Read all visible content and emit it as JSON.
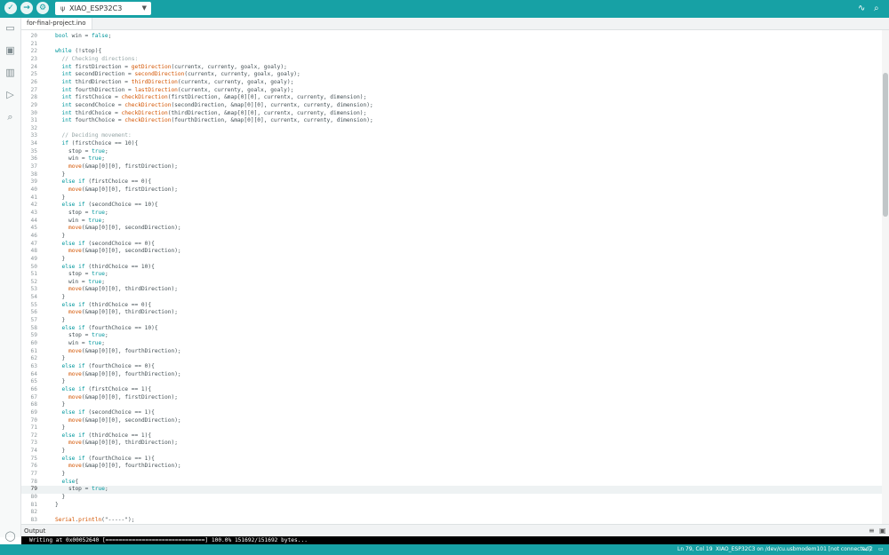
{
  "colors": {
    "accent": "#17a1a5",
    "keyword": "#00979d",
    "function": "#d35400",
    "comment": "#95a5a6",
    "text": "#434f54"
  },
  "toolbar": {
    "verify_icon": "check-icon",
    "upload_icon": "arrow-right-icon",
    "debug_icon": "debug-icon",
    "board_name": "XIAO_ESP32C3",
    "board_icon": "usb-icon"
  },
  "tab": {
    "label": "for-final-project.ino"
  },
  "code_lines": [
    {
      "n": "20",
      "indent": 1,
      "tokens": [
        [
          "k",
          "bool"
        ],
        [
          "t",
          " win = "
        ],
        [
          "k",
          "false"
        ],
        [
          "t",
          ";"
        ]
      ]
    },
    {
      "n": "21",
      "indent": 0,
      "tokens": []
    },
    {
      "n": "22",
      "indent": 1,
      "tokens": [
        [
          "k",
          "while"
        ],
        [
          "t",
          " (!stop){"
        ]
      ]
    },
    {
      "n": "23",
      "indent": 2,
      "tokens": [
        [
          "c",
          "// Checking directions:"
        ]
      ]
    },
    {
      "n": "24",
      "indent": 2,
      "tokens": [
        [
          "k",
          "int"
        ],
        [
          "t",
          " firstDirection = "
        ],
        [
          "f",
          "getDirection"
        ],
        [
          "t",
          "(currentx, currenty, goalx, goaly);"
        ]
      ]
    },
    {
      "n": "25",
      "indent": 2,
      "tokens": [
        [
          "k",
          "int"
        ],
        [
          "t",
          " secondDirection = "
        ],
        [
          "f",
          "secondDirection"
        ],
        [
          "t",
          "(currentx, currenty, goalx, goaly);"
        ]
      ]
    },
    {
      "n": "26",
      "indent": 2,
      "tokens": [
        [
          "k",
          "int"
        ],
        [
          "t",
          " thirdDirection = "
        ],
        [
          "f",
          "thirdDirection"
        ],
        [
          "t",
          "(currentx, currenty, goalx, goaly);"
        ]
      ]
    },
    {
      "n": "27",
      "indent": 2,
      "tokens": [
        [
          "k",
          "int"
        ],
        [
          "t",
          " fourthDirection = "
        ],
        [
          "f",
          "lastDirection"
        ],
        [
          "t",
          "(currentx, currenty, goalx, goaly);"
        ]
      ]
    },
    {
      "n": "28",
      "indent": 2,
      "tokens": [
        [
          "k",
          "int"
        ],
        [
          "t",
          " firstChoice = "
        ],
        [
          "f",
          "checkDirection"
        ],
        [
          "t",
          "(firstDirection, &map[0][0], currentx, currenty, dimension);"
        ]
      ]
    },
    {
      "n": "29",
      "indent": 2,
      "tokens": [
        [
          "k",
          "int"
        ],
        [
          "t",
          " secondChoice = "
        ],
        [
          "f",
          "checkDirection"
        ],
        [
          "t",
          "(secondDirection, &map[0][0], currentx, currenty, dimension);"
        ]
      ]
    },
    {
      "n": "30",
      "indent": 2,
      "tokens": [
        [
          "k",
          "int"
        ],
        [
          "t",
          " thirdChoice = "
        ],
        [
          "f",
          "checkDirection"
        ],
        [
          "t",
          "(thirdDirection, &map[0][0], currentx, currenty, dimension);"
        ]
      ]
    },
    {
      "n": "31",
      "indent": 2,
      "tokens": [
        [
          "k",
          "int"
        ],
        [
          "t",
          " fourthChoice = "
        ],
        [
          "f",
          "checkDirection"
        ],
        [
          "t",
          "(fourthDirection, &map[0][0], currentx, currenty, dimension);"
        ]
      ]
    },
    {
      "n": "32",
      "indent": 0,
      "tokens": []
    },
    {
      "n": "33",
      "indent": 2,
      "tokens": [
        [
          "c",
          "// Deciding movement:"
        ]
      ]
    },
    {
      "n": "34",
      "indent": 2,
      "tokens": [
        [
          "k",
          "if"
        ],
        [
          "t",
          " (firstChoice == 10){"
        ]
      ]
    },
    {
      "n": "35",
      "indent": 3,
      "tokens": [
        [
          "t",
          "stop = "
        ],
        [
          "k",
          "true"
        ],
        [
          "t",
          ";"
        ]
      ]
    },
    {
      "n": "36",
      "indent": 3,
      "tokens": [
        [
          "t",
          "win = "
        ],
        [
          "k",
          "true"
        ],
        [
          "t",
          ";"
        ]
      ]
    },
    {
      "n": "37",
      "indent": 3,
      "tokens": [
        [
          "f",
          "move"
        ],
        [
          "t",
          "(&map[0][0], firstDirection);"
        ]
      ]
    },
    {
      "n": "38",
      "indent": 2,
      "tokens": [
        [
          "t",
          "}"
        ]
      ]
    },
    {
      "n": "39",
      "indent": 2,
      "tokens": [
        [
          "k",
          "else"
        ],
        [
          "t",
          " "
        ],
        [
          "k",
          "if"
        ],
        [
          "t",
          " (firstChoice == 0){"
        ]
      ]
    },
    {
      "n": "40",
      "indent": 3,
      "tokens": [
        [
          "f",
          "move"
        ],
        [
          "t",
          "(&map[0][0], firstDirection);"
        ]
      ]
    },
    {
      "n": "41",
      "indent": 2,
      "tokens": [
        [
          "t",
          "}"
        ]
      ]
    },
    {
      "n": "42",
      "indent": 2,
      "tokens": [
        [
          "k",
          "else"
        ],
        [
          "t",
          " "
        ],
        [
          "k",
          "if"
        ],
        [
          "t",
          " (secondChoice == 10){"
        ]
      ]
    },
    {
      "n": "43",
      "indent": 3,
      "tokens": [
        [
          "t",
          "stop = "
        ],
        [
          "k",
          "true"
        ],
        [
          "t",
          ";"
        ]
      ]
    },
    {
      "n": "44",
      "indent": 3,
      "tokens": [
        [
          "t",
          "win = "
        ],
        [
          "k",
          "true"
        ],
        [
          "t",
          ";"
        ]
      ]
    },
    {
      "n": "45",
      "indent": 3,
      "tokens": [
        [
          "f",
          "move"
        ],
        [
          "t",
          "(&map[0][0], secondDirection);"
        ]
      ]
    },
    {
      "n": "46",
      "indent": 2,
      "tokens": [
        [
          "t",
          "}"
        ]
      ]
    },
    {
      "n": "47",
      "indent": 2,
      "tokens": [
        [
          "k",
          "else"
        ],
        [
          "t",
          " "
        ],
        [
          "k",
          "if"
        ],
        [
          "t",
          " (secondChoice == 0){"
        ]
      ]
    },
    {
      "n": "48",
      "indent": 3,
      "tokens": [
        [
          "f",
          "move"
        ],
        [
          "t",
          "(&map[0][0], secondDirection);"
        ]
      ]
    },
    {
      "n": "49",
      "indent": 2,
      "tokens": [
        [
          "t",
          "}"
        ]
      ]
    },
    {
      "n": "50",
      "indent": 2,
      "tokens": [
        [
          "k",
          "else"
        ],
        [
          "t",
          " "
        ],
        [
          "k",
          "if"
        ],
        [
          "t",
          " (thirdChoice == 10){"
        ]
      ]
    },
    {
      "n": "51",
      "indent": 3,
      "tokens": [
        [
          "t",
          "stop = "
        ],
        [
          "k",
          "true"
        ],
        [
          "t",
          ";"
        ]
      ]
    },
    {
      "n": "52",
      "indent": 3,
      "tokens": [
        [
          "t",
          "win = "
        ],
        [
          "k",
          "true"
        ],
        [
          "t",
          ";"
        ]
      ]
    },
    {
      "n": "53",
      "indent": 3,
      "tokens": [
        [
          "f",
          "move"
        ],
        [
          "t",
          "(&map[0][0], thirdDirection);"
        ]
      ]
    },
    {
      "n": "54",
      "indent": 2,
      "tokens": [
        [
          "t",
          "}"
        ]
      ]
    },
    {
      "n": "55",
      "indent": 2,
      "tokens": [
        [
          "k",
          "else"
        ],
        [
          "t",
          " "
        ],
        [
          "k",
          "if"
        ],
        [
          "t",
          " (thirdChoice == 0){"
        ]
      ]
    },
    {
      "n": "56",
      "indent": 3,
      "tokens": [
        [
          "f",
          "move"
        ],
        [
          "t",
          "(&map[0][0], thirdDirection);"
        ]
      ]
    },
    {
      "n": "57",
      "indent": 2,
      "tokens": [
        [
          "t",
          "}"
        ]
      ]
    },
    {
      "n": "58",
      "indent": 2,
      "tokens": [
        [
          "k",
          "else"
        ],
        [
          "t",
          " "
        ],
        [
          "k",
          "if"
        ],
        [
          "t",
          " (fourthChoice == 10){"
        ]
      ]
    },
    {
      "n": "59",
      "indent": 3,
      "tokens": [
        [
          "t",
          "stop = "
        ],
        [
          "k",
          "true"
        ],
        [
          "t",
          ";"
        ]
      ]
    },
    {
      "n": "60",
      "indent": 3,
      "tokens": [
        [
          "t",
          "win = "
        ],
        [
          "k",
          "true"
        ],
        [
          "t",
          ";"
        ]
      ]
    },
    {
      "n": "61",
      "indent": 3,
      "tokens": [
        [
          "f",
          "move"
        ],
        [
          "t",
          "(&map[0][0], fourthDirection);"
        ]
      ]
    },
    {
      "n": "62",
      "indent": 2,
      "tokens": [
        [
          "t",
          "}"
        ]
      ]
    },
    {
      "n": "63",
      "indent": 2,
      "tokens": [
        [
          "k",
          "else"
        ],
        [
          "t",
          " "
        ],
        [
          "k",
          "if"
        ],
        [
          "t",
          " (fourthChoice == 0){"
        ]
      ]
    },
    {
      "n": "64",
      "indent": 3,
      "tokens": [
        [
          "f",
          "move"
        ],
        [
          "t",
          "(&map[0][0], fourthDirection);"
        ]
      ]
    },
    {
      "n": "65",
      "indent": 2,
      "tokens": [
        [
          "t",
          "}"
        ]
      ]
    },
    {
      "n": "66",
      "indent": 2,
      "tokens": [
        [
          "k",
          "else"
        ],
        [
          "t",
          " "
        ],
        [
          "k",
          "if"
        ],
        [
          "t",
          " (firstChoice == 1){"
        ]
      ]
    },
    {
      "n": "67",
      "indent": 3,
      "tokens": [
        [
          "f",
          "move"
        ],
        [
          "t",
          "(&map[0][0], firstDirection);"
        ]
      ]
    },
    {
      "n": "68",
      "indent": 2,
      "tokens": [
        [
          "t",
          "}"
        ]
      ]
    },
    {
      "n": "69",
      "indent": 2,
      "tokens": [
        [
          "k",
          "else"
        ],
        [
          "t",
          " "
        ],
        [
          "k",
          "if"
        ],
        [
          "t",
          " (secondChoice == 1){"
        ]
      ]
    },
    {
      "n": "70",
      "indent": 3,
      "tokens": [
        [
          "f",
          "move"
        ],
        [
          "t",
          "(&map[0][0], secondDirection);"
        ]
      ]
    },
    {
      "n": "71",
      "indent": 2,
      "tokens": [
        [
          "t",
          "}"
        ]
      ]
    },
    {
      "n": "72",
      "indent": 2,
      "tokens": [
        [
          "k",
          "else"
        ],
        [
          "t",
          " "
        ],
        [
          "k",
          "if"
        ],
        [
          "t",
          " (thirdChoice == 1){"
        ]
      ]
    },
    {
      "n": "73",
      "indent": 3,
      "tokens": [
        [
          "f",
          "move"
        ],
        [
          "t",
          "(&map[0][0], thirdDirection);"
        ]
      ]
    },
    {
      "n": "74",
      "indent": 2,
      "tokens": [
        [
          "t",
          "}"
        ]
      ]
    },
    {
      "n": "75",
      "indent": 2,
      "tokens": [
        [
          "k",
          "else"
        ],
        [
          "t",
          " "
        ],
        [
          "k",
          "if"
        ],
        [
          "t",
          " (fourthChoice == 1){"
        ]
      ]
    },
    {
      "n": "76",
      "indent": 3,
      "tokens": [
        [
          "f",
          "move"
        ],
        [
          "t",
          "(&map[0][0], fourthDirection);"
        ]
      ]
    },
    {
      "n": "77",
      "indent": 2,
      "tokens": [
        [
          "t",
          "}"
        ]
      ]
    },
    {
      "n": "78",
      "indent": 2,
      "tokens": [
        [
          "k",
          "else"
        ],
        [
          "t",
          "{"
        ]
      ]
    },
    {
      "n": "79",
      "indent": 3,
      "active": true,
      "tokens": [
        [
          "t",
          "stop = "
        ],
        [
          "k",
          "true"
        ],
        [
          "t",
          ";"
        ]
      ]
    },
    {
      "n": "80",
      "indent": 2,
      "tokens": [
        [
          "t",
          "}"
        ]
      ]
    },
    {
      "n": "81",
      "indent": 1,
      "tokens": [
        [
          "t",
          "}"
        ]
      ]
    },
    {
      "n": "82",
      "indent": 0,
      "tokens": []
    },
    {
      "n": "83",
      "indent": 1,
      "tokens": [
        [
          "s",
          "Serial"
        ],
        [
          "t",
          "."
        ],
        [
          "f",
          "println"
        ],
        [
          "t",
          "(\"-----\");"
        ]
      ]
    }
  ],
  "output": {
    "title": "Output",
    "text": "Writing at 0x00052640 [==============================] 100.0% 151692/151692 bytes..."
  },
  "status": {
    "position": "Ln 79, Col 19",
    "board": "XIAO_ESP32C3 on /dev/cu.usbmodem101 [not connected]",
    "notifications": "2"
  }
}
